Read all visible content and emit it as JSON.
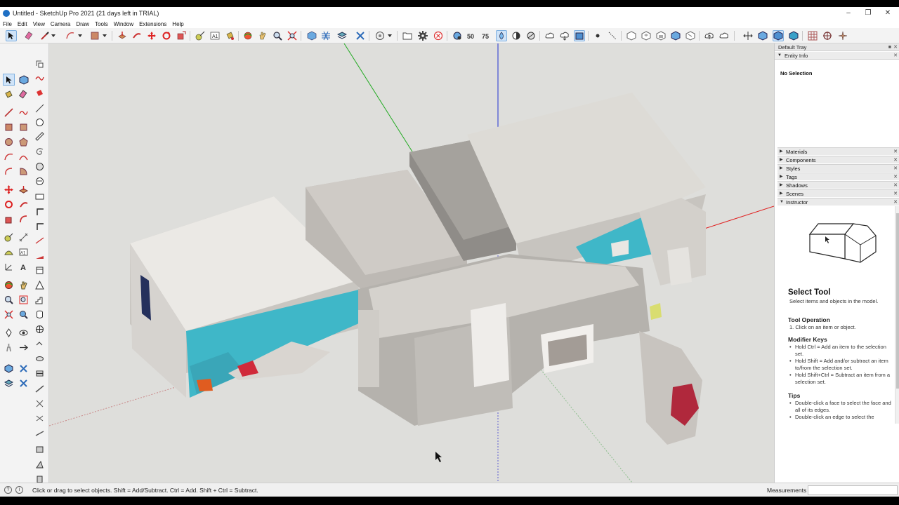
{
  "window": {
    "title": "Untitled - SketchUp Pro 2021 (21 days left in TRIAL)",
    "minimize": "–",
    "maximize": "❐",
    "close": "✕"
  },
  "menu": [
    "File",
    "Edit",
    "View",
    "Camera",
    "Draw",
    "Tools",
    "Window",
    "Extensions",
    "Help"
  ],
  "toolbar": {
    "active_tool": "select",
    "icons": [
      "select-arrow-icon",
      "eraser-icon",
      "pencil-icon",
      "arc-icon",
      "shape-icon",
      "push-pull-icon",
      "follow-me-icon",
      "move-icon",
      "rotate-icon",
      "scale-icon",
      "tape-measure-icon",
      "text-icon",
      "paint-bucket-icon",
      "orbit-icon",
      "pan-icon",
      "zoom-icon",
      "zoom-extents-icon",
      "components-icon",
      "sandbox-icon",
      "layers-icon",
      "solid-tools-icon",
      "warehouse-icon",
      "open-folder-icon",
      "settings-gear-icon",
      "stop-icon",
      "scan-icon",
      "section-icon",
      "styles-icon",
      "xray-icon",
      "backedges-icon",
      "wireframe-icon",
      "shaded-icon",
      "cloud-icon",
      "camera-icon",
      "point-icon",
      "line-icon",
      "views-icon",
      "share-icon",
      "axes-icon",
      "grid-icon",
      "compass-icon"
    ]
  },
  "tray": {
    "title": "Default Tray",
    "entity_info": {
      "label": "Entity Info",
      "selection": "No Selection"
    },
    "panels": [
      "Materials",
      "Components",
      "Styles",
      "Tags",
      "Shadows",
      "Scenes",
      "Instructor"
    ],
    "instructor": {
      "title": "Select Tool",
      "description": "Select items and objects in the model.",
      "operation_heading": "Tool Operation",
      "operation_steps": [
        "1. Click on an item or object."
      ],
      "modifier_heading": "Modifier Keys",
      "modifiers": [
        "Hold Ctrl = Add an item to the selection set.",
        "Hold Shift = Add and/or subtract an item to/from the selection set.",
        "Hold Shift+Ctrl = Subtract an item from a selection set."
      ],
      "tips_heading": "Tips",
      "tips": [
        "Double-click a face to select the face and all of its edges.",
        "Double-click an edge to select the"
      ]
    }
  },
  "status": {
    "message": "Click or drag to select objects. Shift = Add/Subtract. Ctrl = Add. Shift + Ctrl = Subtract.",
    "measurements_label": "Measurements",
    "measurements_value": ""
  },
  "colors": {
    "axis_red": "#e02020",
    "axis_green": "#22aa22",
    "axis_blue": "#2030d0",
    "wall_teal": "#3fb7c8",
    "viewport_bg": "#dededb"
  }
}
